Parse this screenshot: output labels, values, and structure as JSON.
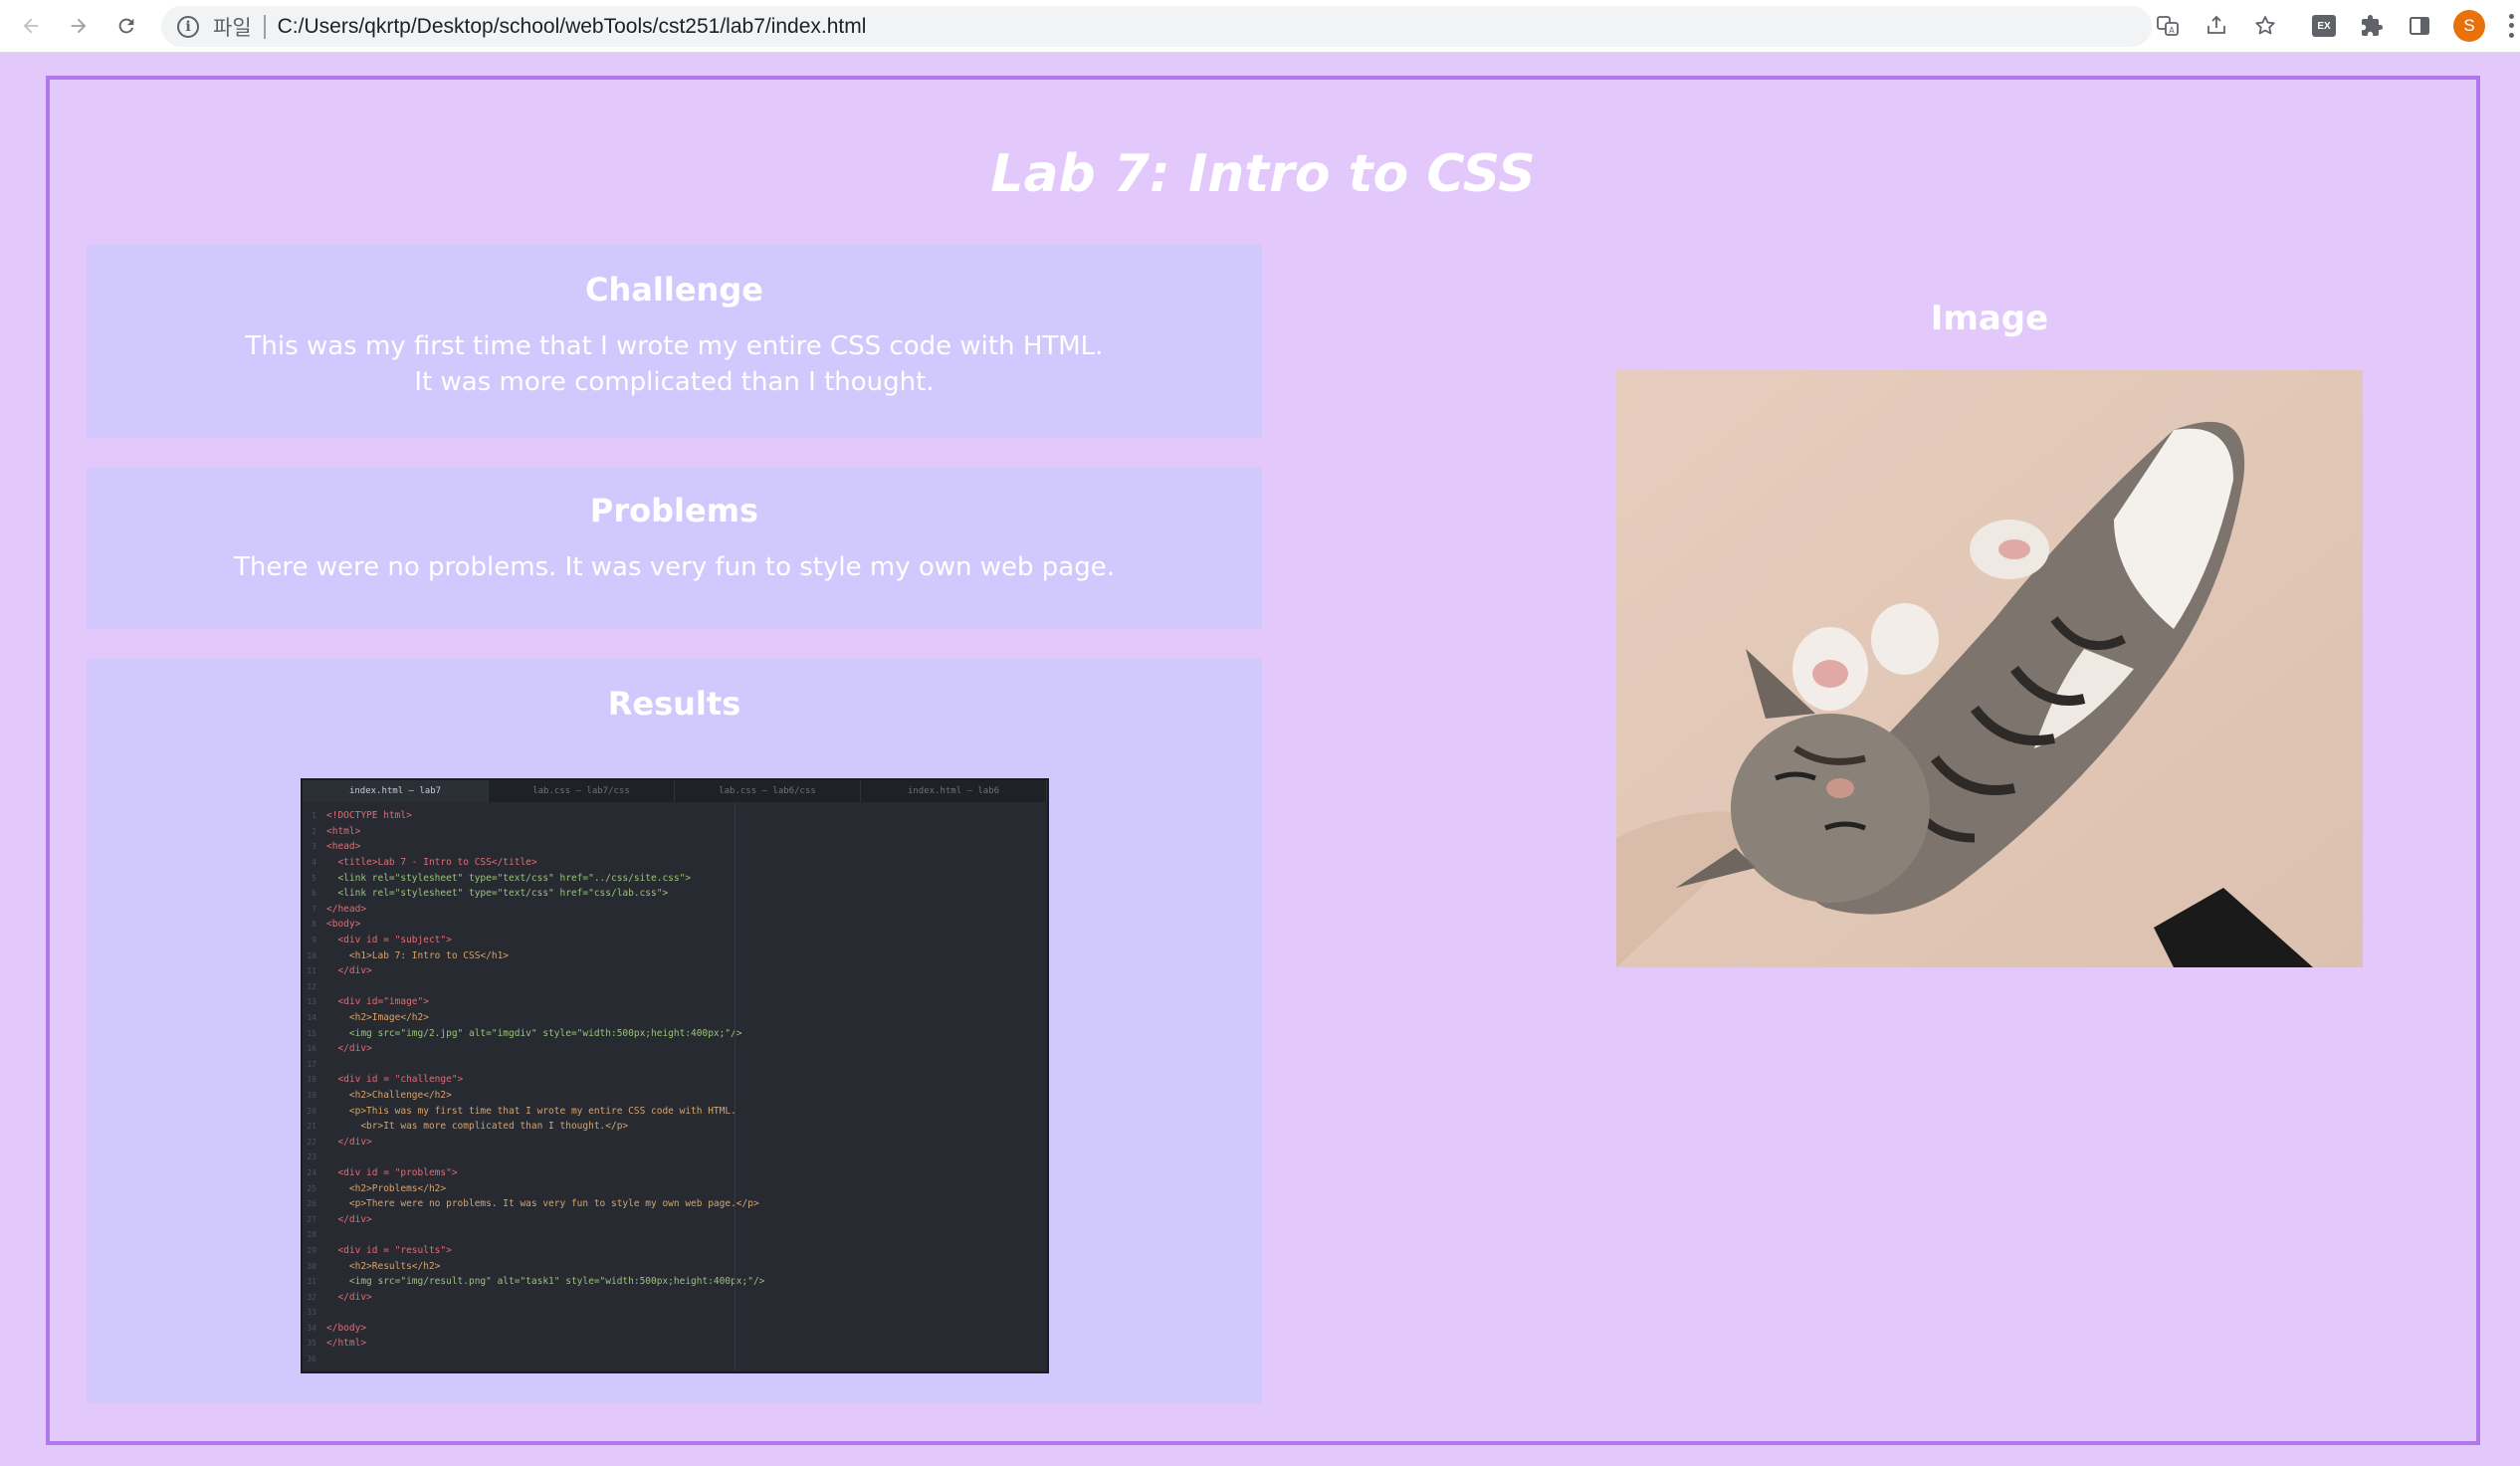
{
  "browser": {
    "back_icon": "arrow-left-icon",
    "forward_icon": "arrow-right-icon",
    "reload_icon": "reload-icon",
    "scheme_label": "파일",
    "url": "C:/Users/qkrtp/Desktop/school/webTools/cst251/lab7/index.html",
    "translate_icon": "translate-icon",
    "share_icon": "share-icon",
    "bookmark_icon": "star-icon",
    "ex_badge": "EX",
    "extensions_icon": "puzzle-icon",
    "side_panel_icon": "side-panel-icon",
    "avatar_letter": "S",
    "avatar_color": "#e8710a"
  },
  "page": {
    "title": "Lab 7: Intro to CSS",
    "background": "#e2c8fb",
    "card_color": "#d1c9fd",
    "border_color": "#b178ee"
  },
  "challenge": {
    "heading": "Challenge",
    "line1": "This was my first time that I wrote my entire CSS code with HTML.",
    "line2": "It was more complicated than I thought."
  },
  "problems": {
    "heading": "Problems",
    "text": "There were no problems. It was very fun to style my own web page."
  },
  "results": {
    "heading": "Results",
    "screenshot": {
      "tabs": [
        "index.html — lab7",
        "lab.css — lab7/css",
        "lab.css — lab6/css",
        "index.html — lab6"
      ],
      "lines": [
        "<!DOCTYPE html>",
        "<html>",
        "<head>",
        "  <title>Lab 7 - Intro to CSS</title>",
        "  <link rel=\"stylesheet\" type=\"text/css\" href=\"../css/site.css\">",
        "  <link rel=\"stylesheet\" type=\"text/css\" href=\"css/lab.css\">",
        "</head>",
        "<body>",
        "  <div id = \"subject\">",
        "    <h1>Lab 7: Intro to CSS</h1>",
        "  </div>",
        "",
        "  <div id=\"image\">",
        "    <h2>Image</h2>",
        "    <img src=\"img/2.jpg\" alt=\"imgdiv\" style=\"width:500px;height:400px;\"/>",
        "  </div>",
        "",
        "  <div id = \"challenge\">",
        "    <h2>Challenge</h2>",
        "    <p>This was my first time that I wrote my entire CSS code with HTML.",
        "      <br>It was more complicated than I thought.</p>",
        "  </div>",
        "",
        "  <div id = \"problems\">",
        "    <h2>Problems</h2>",
        "    <p>There were no problems. It was very fun to style my own web page.</p>",
        "  </div>",
        "",
        "  <div id = \"results\">",
        "    <h2>Results</h2>",
        "    <img src=\"img/result.png\" alt=\"task1\" style=\"width:500px;height:400px;\"/>",
        "  </div>",
        "",
        "</body>",
        "</html>",
        ""
      ]
    }
  },
  "image_section": {
    "heading": "Image",
    "photo_subject": "sleeping-kitten-photo"
  }
}
